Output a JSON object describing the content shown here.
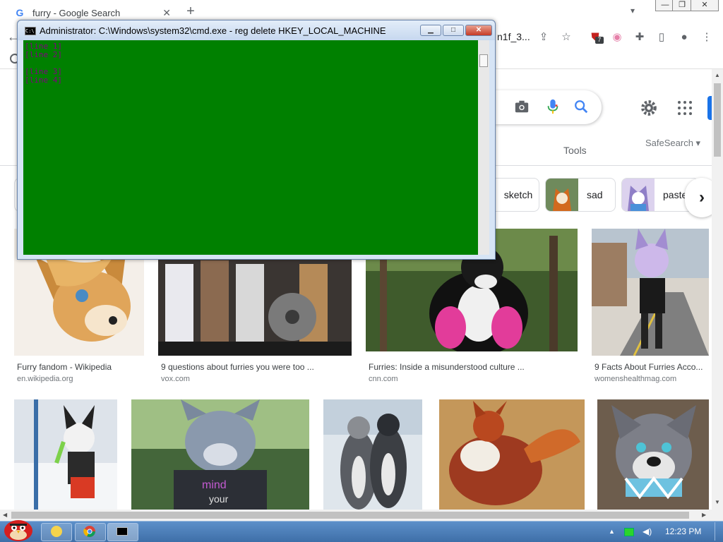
{
  "browser": {
    "tab_title": "furry - Google Search",
    "tab_close": "✕",
    "new_tab": "+",
    "url_fragment": "n1f_3...",
    "ext_badge": "7",
    "window_min": "—",
    "window_restore": "❐",
    "window_close": "✕"
  },
  "search": {
    "tools_label": "Tools",
    "safesearch_label": "SafeSearch ▾"
  },
  "chips": [
    {
      "label": "sketch"
    },
    {
      "label": "sad"
    },
    {
      "label": "paste"
    }
  ],
  "results_row1": [
    {
      "title": "Furry fandom - Wikipedia",
      "source": "en.wikipedia.org"
    },
    {
      "title": "9 questions about furries you were too ...",
      "source": "vox.com"
    },
    {
      "title": "Furries: Inside a misunderstood culture ...",
      "source": "cnn.com"
    },
    {
      "title": "9 Facts About Furries Acco...",
      "source": "womenshealthmag.com"
    }
  ],
  "cmd": {
    "title": "Administrator: C:\\Windows\\system32\\cmd.exe - reg  delete HKEY_LOCAL_MACHINE",
    "lines": [
      "[line 1]",
      "[line 2]",
      "[line 3]",
      "[line 4]"
    ],
    "text_color": "#800080",
    "background_color": "#008000"
  },
  "taskbar": {
    "clock": "12:23 PM"
  },
  "colors": {
    "google_blue": "#1a73e8",
    "taskbar_blue": "#3e6fa8"
  }
}
